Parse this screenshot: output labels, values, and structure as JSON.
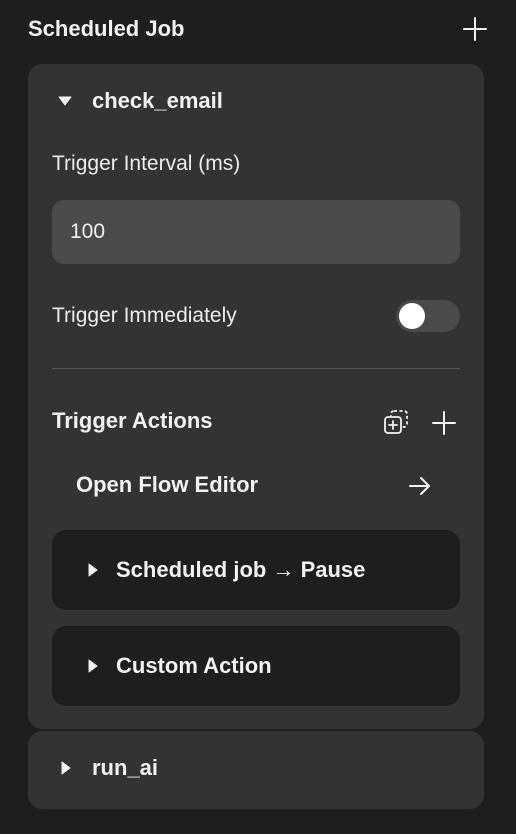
{
  "header": {
    "title": "Scheduled Job"
  },
  "jobs": [
    {
      "name": "check_email",
      "expanded": true,
      "interval_label": "Trigger Interval (ms)",
      "interval_value": "100",
      "immediate_label": "Trigger Immediately",
      "immediate_on": false,
      "actions_title": "Trigger Actions",
      "flow_editor_label": "Open Flow Editor",
      "actions": [
        {
          "label": "Scheduled job → Pause"
        },
        {
          "label": "Custom Action"
        }
      ]
    },
    {
      "name": "run_ai",
      "expanded": false
    }
  ],
  "icons": {
    "add": "plus-icon",
    "add_existing": "add-copy-icon",
    "expanded": "caret-down-icon",
    "collapsed": "caret-right-icon",
    "open": "arrow-right-icon"
  },
  "colors": {
    "background": "#1e1e1e",
    "card": "#333333",
    "input": "#4a4a4a",
    "action_card": "#1e1e1e",
    "text": "#f2f2f2"
  }
}
